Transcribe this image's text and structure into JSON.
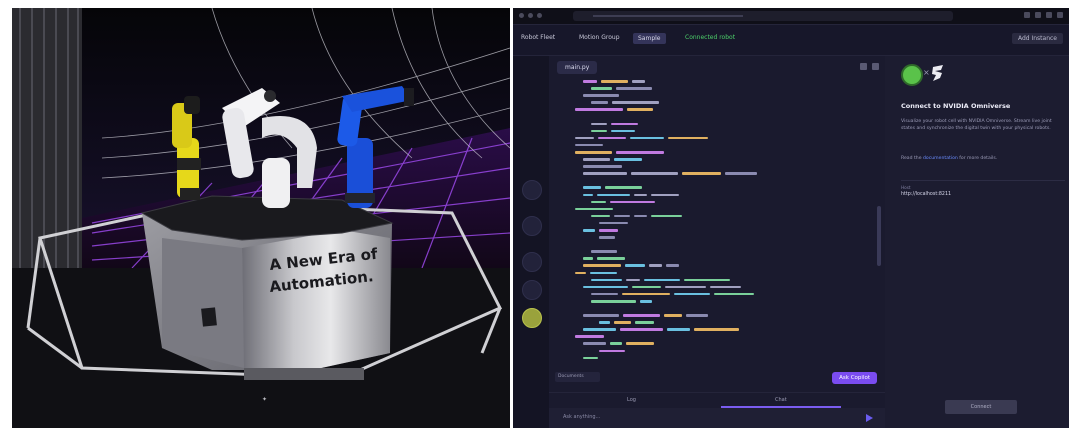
{
  "photo": {
    "headline": "A New Era of Automation."
  },
  "ide": {
    "toolbar": {
      "app_name": "Robot Fleet",
      "workspace": "Motion Group",
      "chip": "Sample",
      "status": "Connected robot",
      "right_button": "Add Instance"
    },
    "editor": {
      "tab_label": "main.py",
      "chat_button": "Ask Copilot",
      "panel_label": "Documents",
      "bottom_tabs": [
        "Log",
        "Chat"
      ],
      "prompt_placeholder": "Ask anything..."
    },
    "panel": {
      "title": "Connect to NVIDIA Omniverse",
      "description": "Visualize your robot cell with NVIDIA Omniverse. Stream live joint states and synchronize the digital twin with your physical robots.",
      "link_prefix": "Read the",
      "link_text": "documentation",
      "link_suffix": "for more details.",
      "input_label": "Host",
      "input_value": "http://localhost:8211",
      "connect_button": "Connect"
    }
  }
}
